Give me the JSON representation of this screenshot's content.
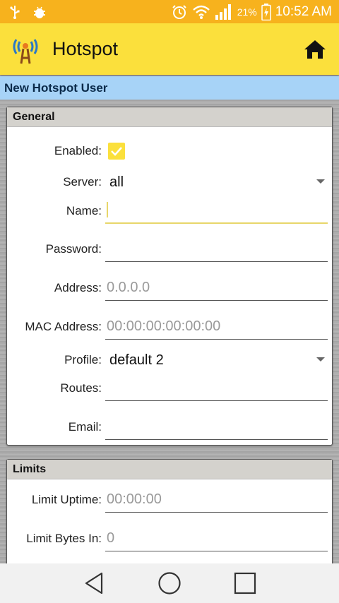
{
  "status_bar": {
    "icons": [
      "usb-icon",
      "android-debug-icon",
      "alarm-icon",
      "wifi-icon",
      "signal-icon",
      "battery-charging-icon"
    ],
    "battery": "21%",
    "time": "10:52 AM",
    "color": "#f7b21d"
  },
  "app_bar": {
    "title": "Hotspot",
    "logo_icon": "antenna-logo-icon",
    "home_icon": "home-icon",
    "color": "#fbe03c"
  },
  "subheader": {
    "title": "New Hotspot User",
    "color": "#a7d3f7"
  },
  "general": {
    "title": "General",
    "enabled": {
      "label": "Enabled:",
      "checked": true
    },
    "server": {
      "label": "Server:",
      "value": "all"
    },
    "name": {
      "label": "Name:",
      "value": ""
    },
    "password": {
      "label": "Password:",
      "value": ""
    },
    "address": {
      "label": "Address:",
      "placeholder": "0.0.0.0"
    },
    "mac_address": {
      "label": "MAC Address:",
      "placeholder": "00:00:00:00:00:00"
    },
    "profile": {
      "label": "Profile:",
      "value": "default 2"
    },
    "routes": {
      "label": "Routes:",
      "value": ""
    },
    "email": {
      "label": "Email:",
      "value": ""
    }
  },
  "limits": {
    "title": "Limits",
    "limit_uptime": {
      "label": "Limit Uptime:",
      "placeholder": "00:00:00"
    },
    "limit_bytes_in": {
      "label": "Limit Bytes In:",
      "placeholder": "0"
    }
  },
  "nav_bar": {
    "icons": [
      "back-icon",
      "home-circle-icon",
      "recents-icon"
    ]
  }
}
